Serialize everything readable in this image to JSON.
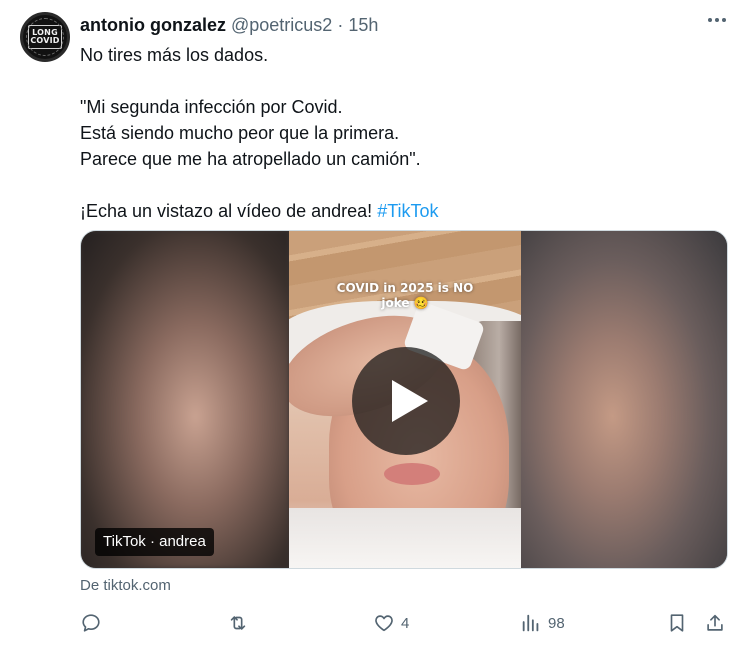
{
  "tweet": {
    "author_name": "antonio gonzalez",
    "handle": "@poetricus2",
    "separator": "·",
    "time": "15h",
    "avatar": {
      "line1": "LONG",
      "line2": "COVID"
    },
    "paragraphs": [
      "No tires más los dados.",
      "\"Mi segunda infección por Covid.\nEstá siendo mucho peor que la primera.\nParece que me ha atropellado un camión\"."
    ],
    "last_line": {
      "text": "¡Echa un vistazo al vídeo de andrea! ",
      "hashtag": "#TikTok"
    }
  },
  "media": {
    "video_caption": "COVID in 2025 is NO\njoke 🥴",
    "source_badge": "TikTok · andrea"
  },
  "link_source": "De tiktok.com",
  "actions": {
    "reply": {
      "icon": "reply-icon"
    },
    "retweet": {
      "icon": "retweet-icon"
    },
    "like": {
      "icon": "heart-icon",
      "count": "4"
    },
    "views": {
      "icon": "views-icon",
      "count": "98"
    },
    "bookmark": {
      "icon": "bookmark-icon"
    },
    "share": {
      "icon": "share-icon"
    }
  },
  "colors": {
    "text": "#0f1419",
    "muted": "#536471",
    "link": "#1d9bf0"
  }
}
